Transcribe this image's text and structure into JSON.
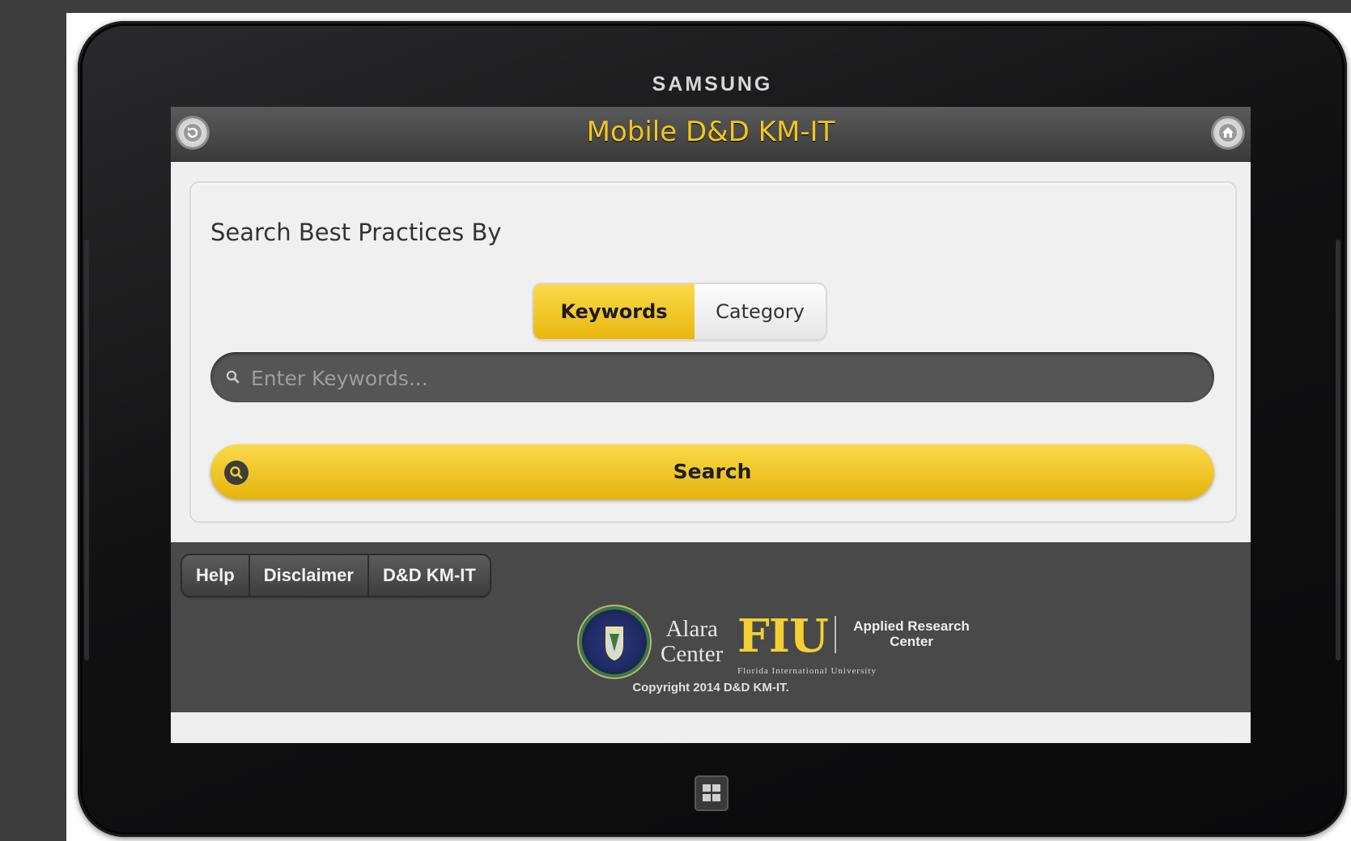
{
  "device": {
    "brand": "SAMSUNG"
  },
  "header": {
    "title": "Mobile D&D KM-IT",
    "back_icon": "back-circle-icon",
    "home_icon": "home-icon"
  },
  "search_panel": {
    "heading": "Search Best Practices By",
    "mode_tabs": [
      {
        "label": "Keywords",
        "selected": true
      },
      {
        "label": "Category",
        "selected": false
      }
    ],
    "input": {
      "placeholder": "Enter Keywords...",
      "value": ""
    },
    "search_button_label": "Search"
  },
  "footer": {
    "nav": [
      {
        "label": "Help"
      },
      {
        "label": "Disclaimer"
      },
      {
        "label": "D&D KM-IT"
      }
    ],
    "logos": {
      "alara_line1": "Alara",
      "alara_line2": "Center",
      "fiu": "FIU",
      "arc_line1": "Applied Research",
      "arc_line2": "Center",
      "fiu_subtitle": "Florida International University"
    },
    "copyright": "Copyright 2014 D&D KM-IT."
  },
  "colors": {
    "accent_yellow": "#f2c61f",
    "header_dark": "#4a4a4a",
    "footer_dark": "#494949"
  }
}
